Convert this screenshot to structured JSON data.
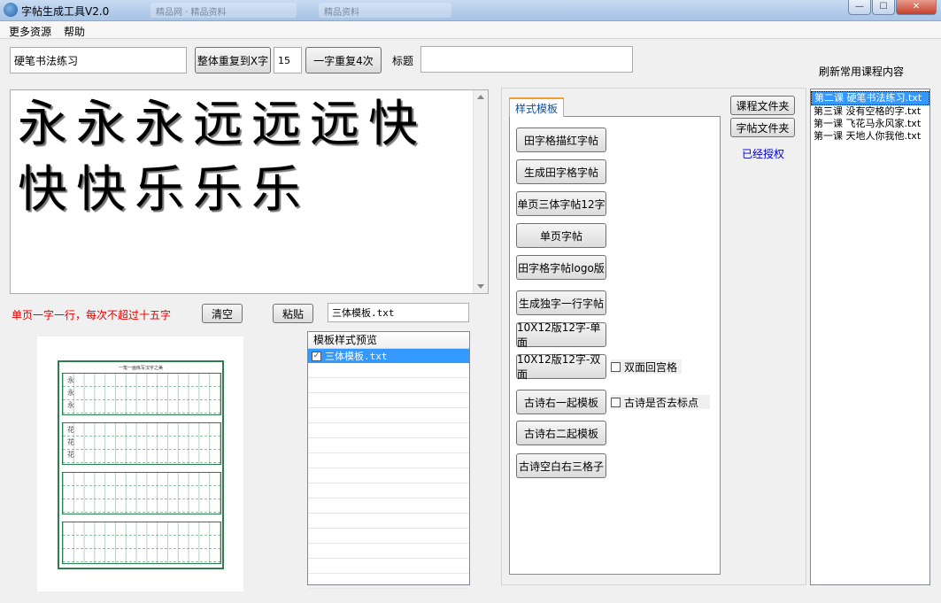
{
  "window": {
    "title": "字帖生成工具V2.0",
    "ghost_tabs": [
      "精品网 · 精品资料",
      "精品资料"
    ]
  },
  "window_buttons": {
    "minimize": "—",
    "maximize": "☐",
    "close": "✕"
  },
  "menu": [
    "更多资源",
    "帮助"
  ],
  "toolbar": {
    "title_input_value": "硬笔书法练习",
    "repeat_all_button": "整体重复到X字",
    "count_value": "15",
    "repeat_each_button": "一字重复4次",
    "heading_label": "标题",
    "heading_value": "",
    "refresh_label": "刷新常用课程内容"
  },
  "editor": {
    "text": "永永永远远远快快快乐乐乐"
  },
  "hint": {
    "text": "单页一字一行，每次不超过十五字",
    "color": "#e00000"
  },
  "actions": {
    "clear": "清空",
    "paste": "粘贴",
    "template_file": "三体模板.txt"
  },
  "preview": {
    "page_title": "一笔一画练写汉字之美",
    "sample_chars": [
      "永",
      "永",
      "永",
      "花",
      "花",
      "花"
    ]
  },
  "template_list": {
    "header": "模板样式预览",
    "items": [
      {
        "label": "三体模板.txt",
        "checked": true
      }
    ]
  },
  "panel": {
    "tab": "样式模板",
    "buttons": [
      "田字格描红字帖",
      "生成田字格字帖",
      "单页三体字帖12字",
      "单页字帖",
      "田字格字帖logo版",
      "生成独字一行字帖",
      "10X12版12字-单面",
      "10X12版12字-双面",
      "古诗右一起模板",
      "古诗右二起模板",
      "古诗空白右三格子"
    ],
    "checkbox_double": "双面回宫格",
    "checkbox_poem": "古诗是否去标点"
  },
  "side": {
    "course_folder": "课程文件夹",
    "copybook_folder": "字帖文件夹",
    "authorized": "已经授权",
    "authorized_color": "#0000cc"
  },
  "courses": [
    "第二课 硬笔书法练习.txt",
    "第三课 没有空格的字.txt",
    "第一课 飞花马永风家.txt",
    "第一课 天地人你我他.txt"
  ],
  "colors": {
    "accent": "#3399ff",
    "grid": "#2e7d4f"
  }
}
